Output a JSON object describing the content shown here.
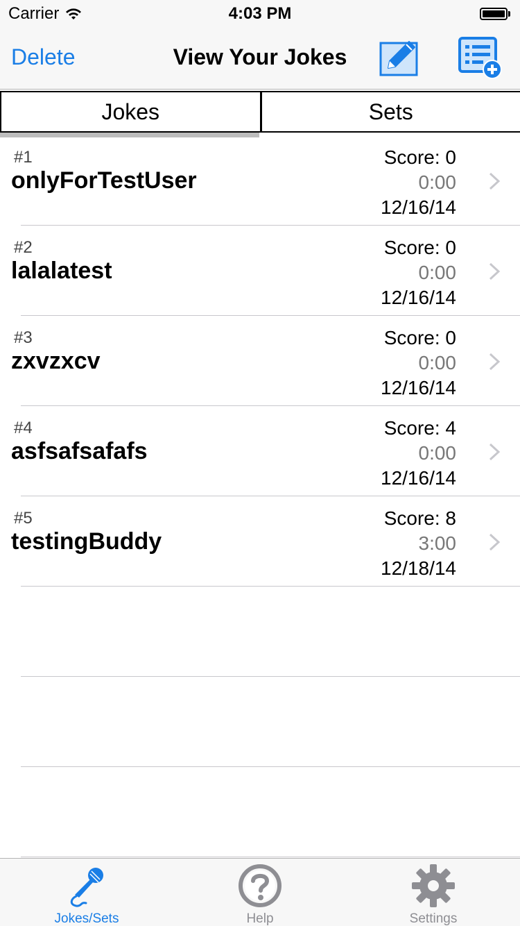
{
  "status_bar": {
    "carrier": "Carrier",
    "time": "4:03 PM"
  },
  "nav": {
    "delete_label": "Delete",
    "title": "View Your Jokes",
    "edit_icon": "compose-icon",
    "new_set_icon": "add-list-icon"
  },
  "segments": {
    "jokes_label": "Jokes",
    "sets_label": "Sets",
    "selected": "Jokes"
  },
  "jokes": [
    {
      "number": "#1",
      "title": "onlyForTestUser",
      "score": "Score: 0",
      "duration": "0:00",
      "date": "12/16/14"
    },
    {
      "number": "#2",
      "title": "lalalatest",
      "score": "Score: 0",
      "duration": "0:00",
      "date": "12/16/14"
    },
    {
      "number": "#3",
      "title": "zxvzxcv",
      "score": "Score: 0",
      "duration": "0:00",
      "date": "12/16/14"
    },
    {
      "number": "#4",
      "title": "asfsafsafafs",
      "score": "Score: 4",
      "duration": "0:00",
      "date": "12/16/14"
    },
    {
      "number": "#5",
      "title": "testingBuddy",
      "score": "Score: 8",
      "duration": "3:00",
      "date": "12/18/14"
    }
  ],
  "tab_bar": {
    "items": [
      {
        "label": "Jokes/Sets",
        "icon": "microphone-icon",
        "active": true
      },
      {
        "label": "Help",
        "icon": "question-icon",
        "active": false
      },
      {
        "label": "Settings",
        "icon": "gear-icon",
        "active": false
      }
    ]
  },
  "colors": {
    "accent": "#1a7ee6",
    "inactive": "#8e8e93",
    "bar_background": "#f7f7f7"
  }
}
